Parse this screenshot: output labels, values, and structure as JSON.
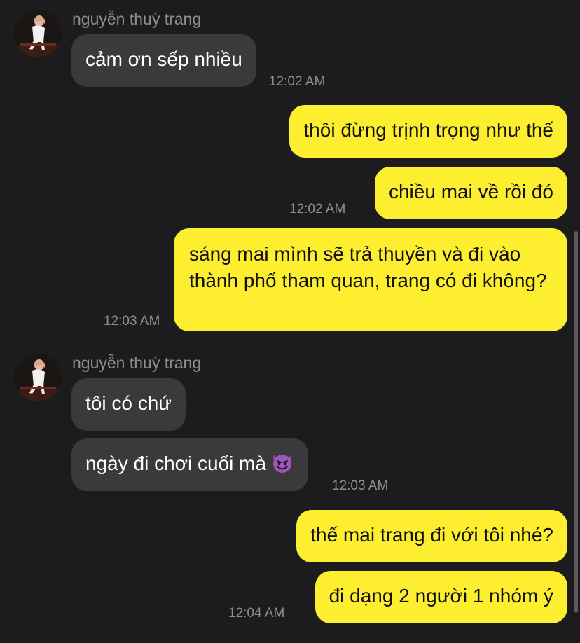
{
  "conversation": {
    "contact_name": "nguyễn thuỳ trang",
    "groups": [
      {
        "sender": "nguyễn thuỳ trang",
        "messages": [
          "cảm ơn sếp nhiều"
        ],
        "time": "12:02 AM"
      },
      {
        "messages": [
          "thôi đừng trịnh trọng như thế",
          "chiều mai về rồi đó"
        ],
        "time": "12:02 AM"
      },
      {
        "messages": [
          "sáng mai mình sẽ trả thuyền và đi vào thành phố tham quan, trang có đi không?"
        ],
        "time": "12:03 AM"
      },
      {
        "sender": "nguyễn thuỳ trang",
        "messages": [
          "tôi có chứ",
          "ngày đi chơi cuối mà"
        ],
        "time": "12:03 AM"
      },
      {
        "messages": [
          "thế mai trang đi với tôi nhé?",
          "đi dạng 2 người 1 nhóm ý"
        ],
        "time": "12:04 AM"
      }
    ]
  },
  "icons": {
    "avatar": "contact-photo",
    "emoji": "smiling-devil-emoji"
  },
  "colors": {
    "background": "#1c1c1e",
    "incoming_bubble": "#3a3a3c",
    "outgoing_bubble": "#fdee30",
    "timestamp": "#8e8e93",
    "devil_emoji": "#8e44ad"
  }
}
